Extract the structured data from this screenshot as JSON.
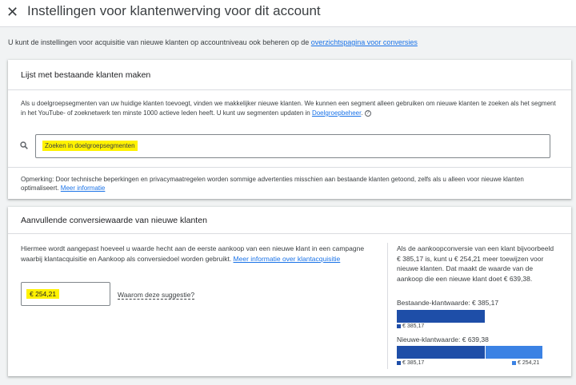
{
  "header": {
    "close_icon": "close-icon",
    "title": "Instellingen voor klantenwerving voor dit account"
  },
  "intro": {
    "text": "U kunt de instellingen voor acquisitie van nieuwe klanten op accountniveau ook beheren op de ",
    "link": "overzichtspagina voor conversies"
  },
  "list_card": {
    "title": "Lijst met bestaande klanten maken",
    "description": "Als u doelgroepsegmenten van uw huidige klanten toevoegt, vinden we makkelijker nieuwe klanten. We kunnen een segment alleen gebruiken om nieuwe klanten te zoeken als het segment in het YouTube- of zoeknetwerk ten minste 1000 actieve leden heeft. U kunt uw segmenten updaten in ",
    "description_link": "Doelgroepbeheer",
    "description_end": ".",
    "help_icon": "help-circle-icon",
    "search_icon": "search-icon",
    "search_placeholder": "Zoeken in doelgroepsegmenten",
    "note": "Opmerking: Door technische beperkingen en privacymaatregelen worden sommige advertenties misschien aan bestaande klanten getoond, zelfs als u alleen voor nieuwe klanten optimaliseert. ",
    "note_link": "Meer informatie"
  },
  "value_card": {
    "title": "Aanvullende conversiewaarde van nieuwe klanten",
    "description": "Hiermee wordt aangepast hoeveel u waarde hecht aan de eerste aankoop van een nieuwe klant in een campagne waarbij klantacquisitie en Aankoop als conversiedoel worden gebruikt. ",
    "description_link": "Meer informatie over klantacquisitie",
    "value": "€ 254,21",
    "why_link": "Waarom deze suggestie?",
    "side_text": "Als de aankoopconversie van een klant bijvoorbeeld € 385,17 is, kunt u € 254,21 meer toewijzen voor nieuwe klanten. Dat maakt de waarde van de aankoop die een nieuwe klant doet € 639,38.",
    "existing_label": "Bestaande-klantwaarde: € 385,17",
    "existing_legend": "€ 385,17",
    "new_label": "Nieuwe-klantwaarde: € 639,38",
    "new_legend_base": "€ 385,17",
    "new_legend_extra": "€ 254,21",
    "existing_value": 385.17,
    "extra_value": 254.21,
    "colors": {
      "base": "#1e4ea8",
      "extra": "#3b82e4",
      "highlight": "#fff200"
    }
  }
}
